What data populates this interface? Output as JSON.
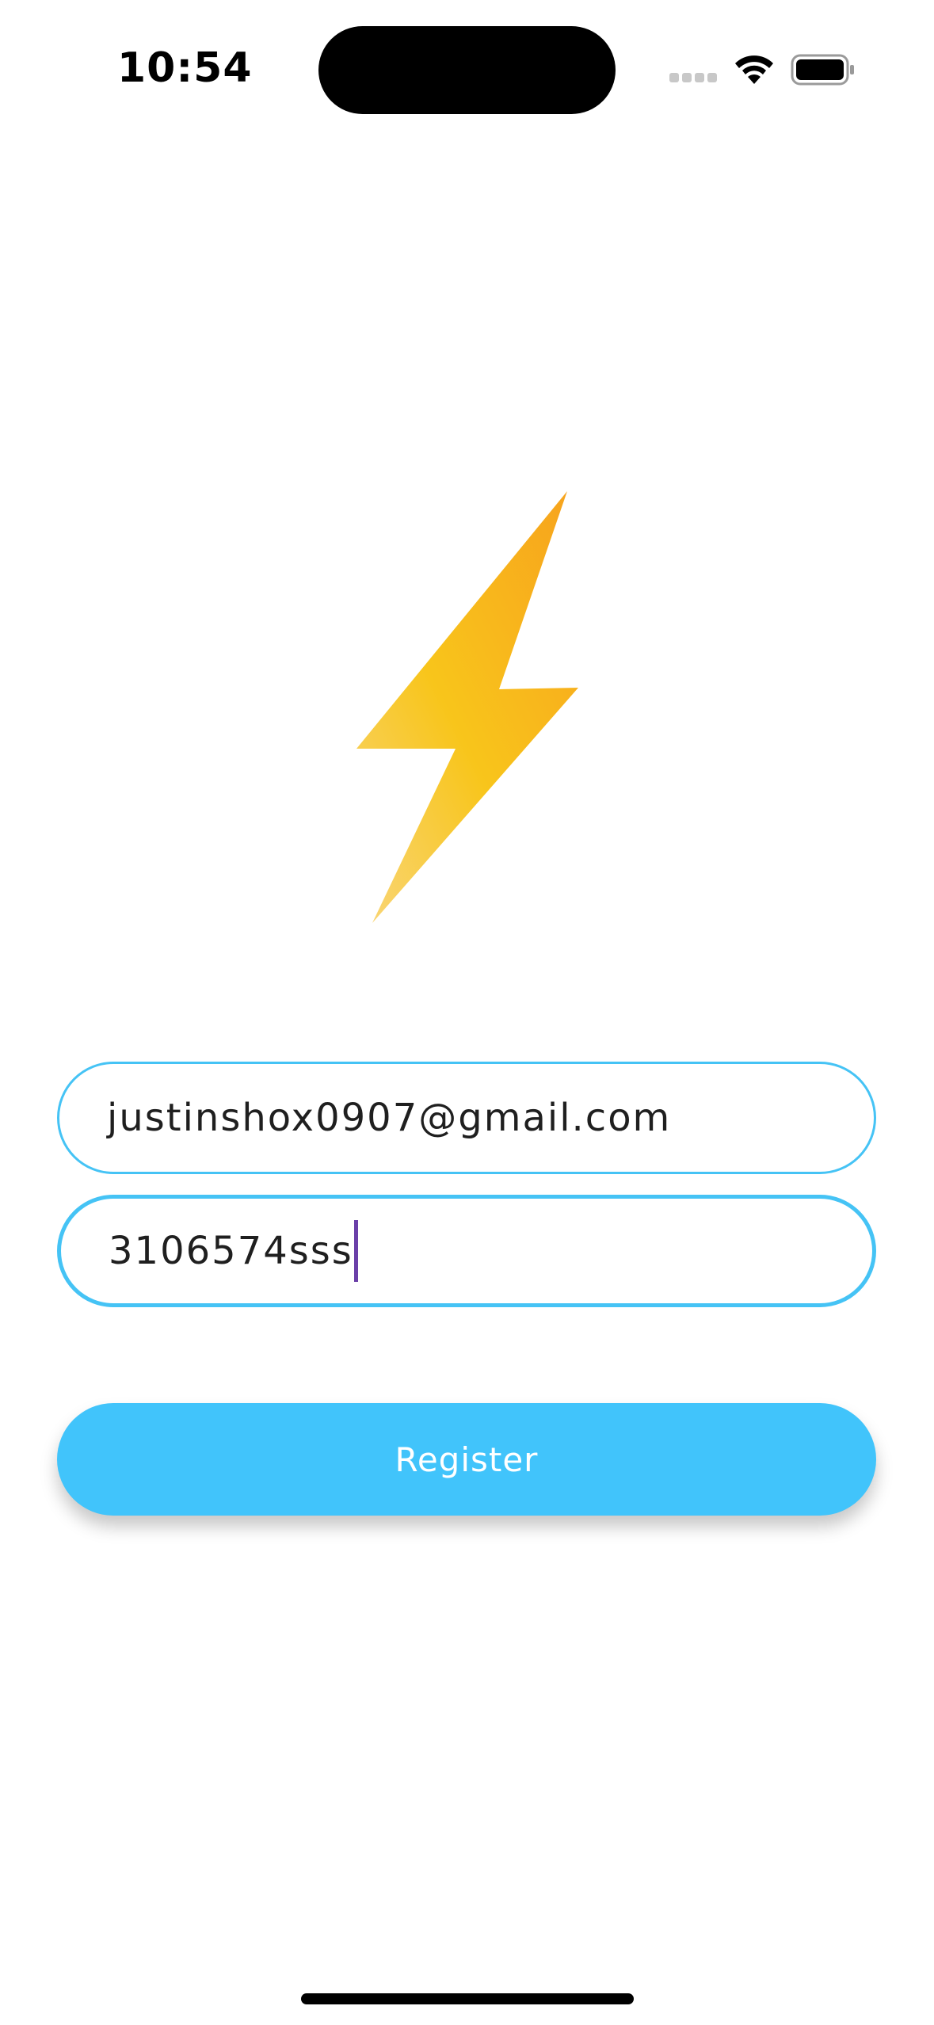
{
  "status_bar": {
    "time": "10:54",
    "icons": [
      "cellular-signal-icon",
      "wifi-icon",
      "battery-icon"
    ]
  },
  "logo": {
    "icon": "lightning-bolt-icon",
    "colors": [
      "#f7a21d",
      "#f8c51b",
      "#f9d67a"
    ]
  },
  "form": {
    "email_value": "justinshox0907@gmail.com",
    "password_value": "3106574sss",
    "register_label": "Register"
  },
  "colors": {
    "accent": "#41c4fb",
    "field_border": "#45c3f5",
    "caret": "#6a3fa8",
    "button_text": "#ffffff"
  }
}
